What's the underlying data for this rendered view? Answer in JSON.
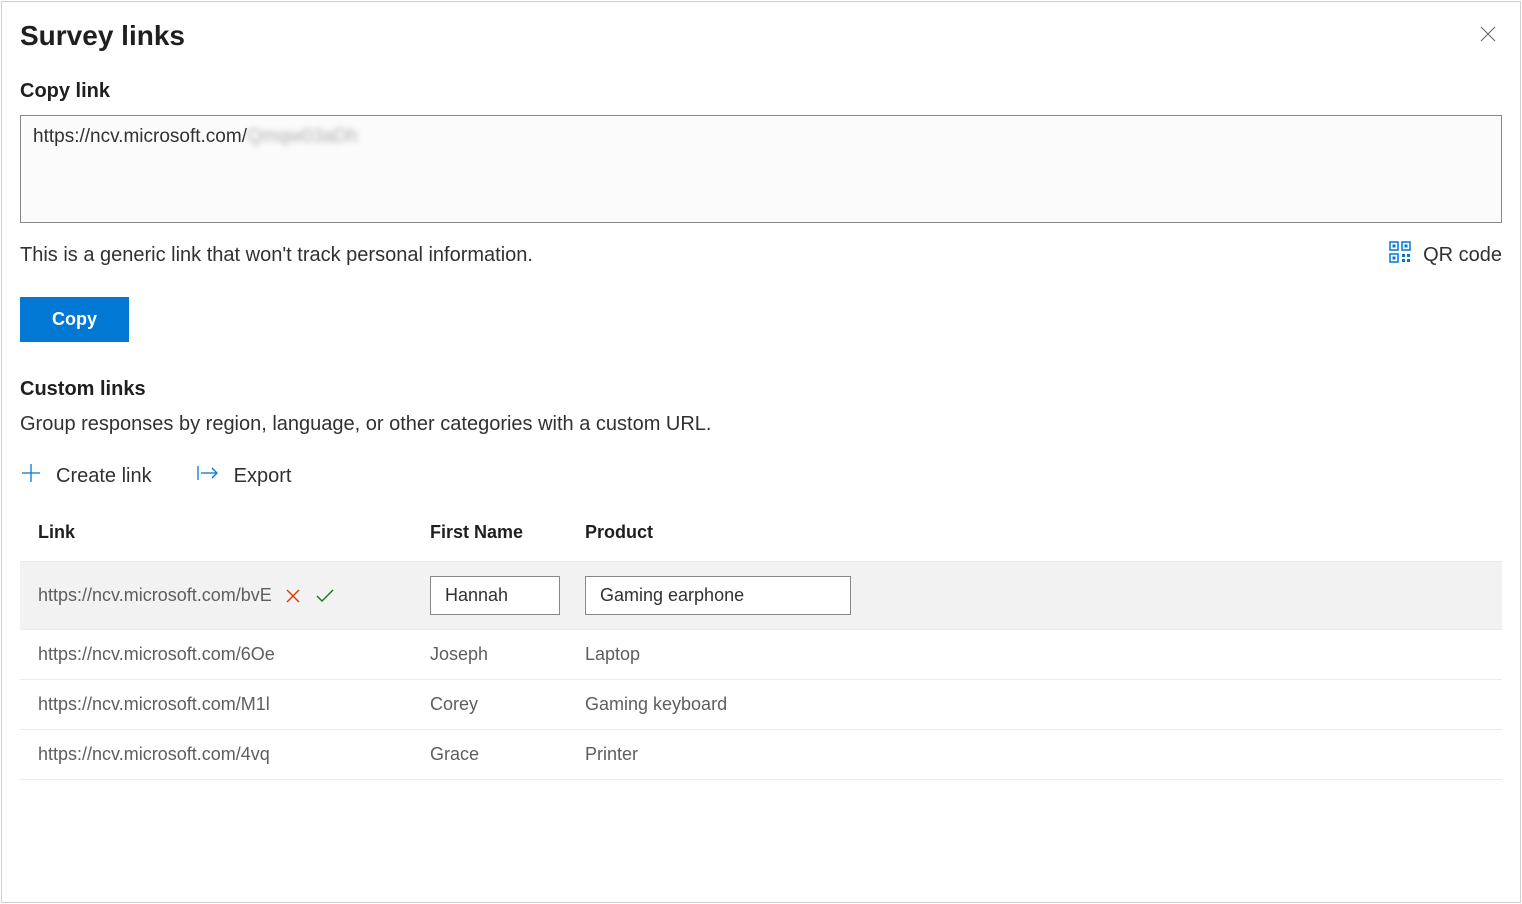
{
  "title": "Survey links",
  "copy_section": {
    "label": "Copy link",
    "url_prefix": "https://ncv.microsoft.com/",
    "url_blurred": "Qmqw03aDh",
    "description": "This is a generic link that won't track personal information.",
    "qr_label": "QR code",
    "copy_button": "Copy"
  },
  "custom_section": {
    "label": "Custom links",
    "description": "Group responses by region, language, or other categories with a custom URL.",
    "create_link": "Create link",
    "export": "Export"
  },
  "table": {
    "headers": {
      "link": "Link",
      "first_name": "First Name",
      "product": "Product"
    },
    "rows": [
      {
        "link": "https://ncv.microsoft.com/bvE",
        "first_name": "Hannah",
        "product": "Gaming earphone",
        "editing": true
      },
      {
        "link": "https://ncv.microsoft.com/6Oe",
        "first_name": "Joseph",
        "product": "Laptop",
        "editing": false
      },
      {
        "link": "https://ncv.microsoft.com/M1l",
        "first_name": "Corey",
        "product": "Gaming keyboard",
        "editing": false
      },
      {
        "link": "https://ncv.microsoft.com/4vq",
        "first_name": "Grace",
        "product": "Printer",
        "editing": false
      }
    ]
  }
}
